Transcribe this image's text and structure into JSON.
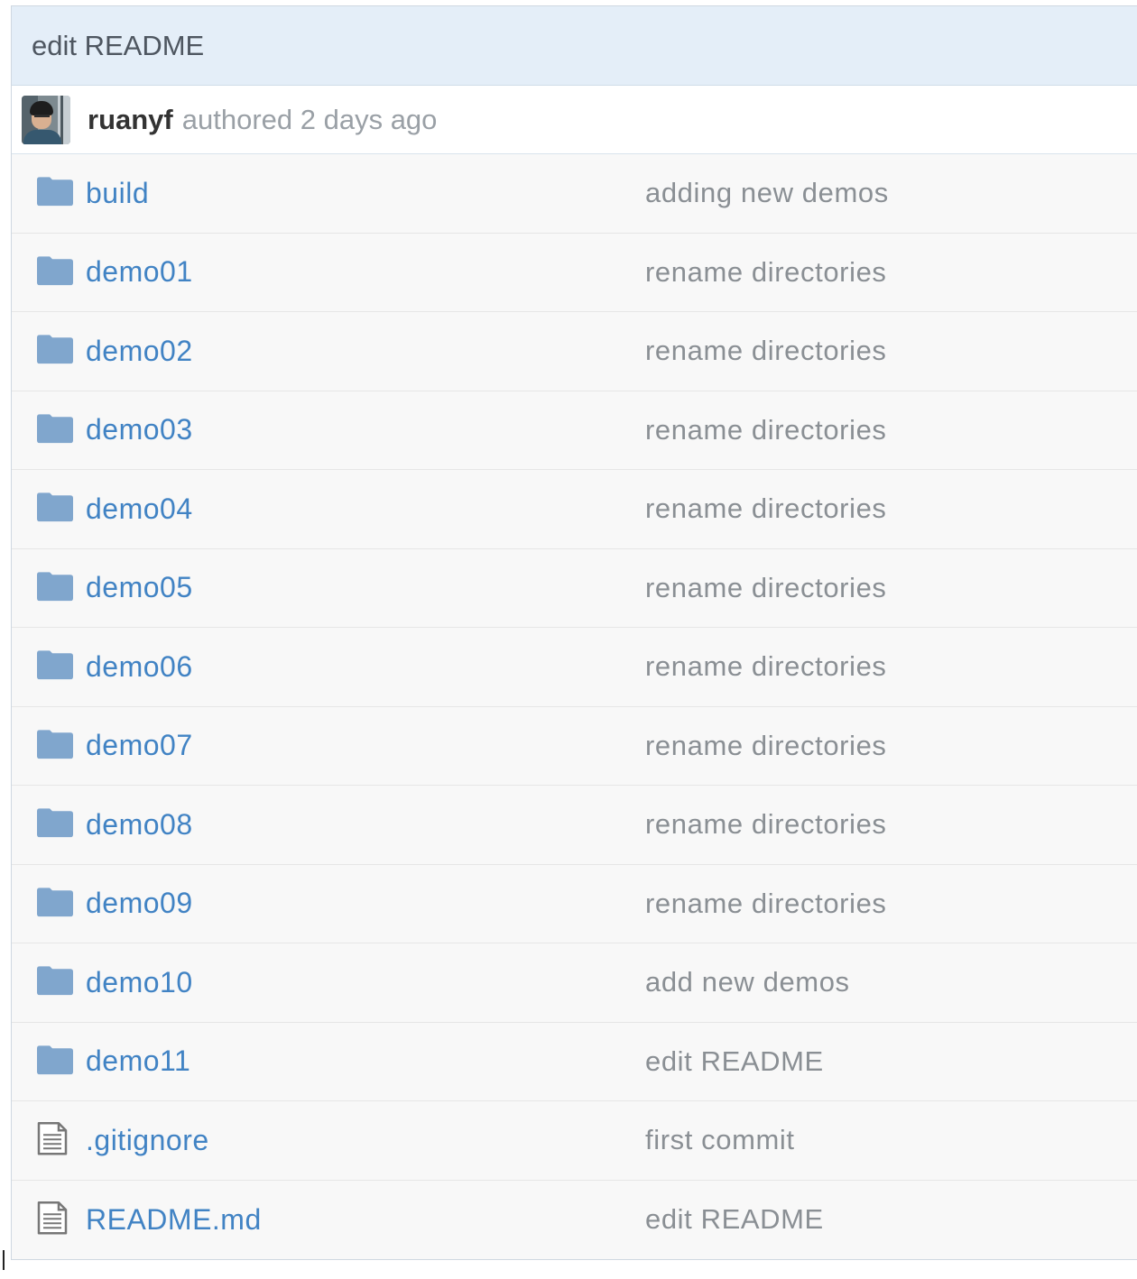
{
  "commit": {
    "title": "edit README",
    "author": "ruanyf",
    "authored_text": "authored 2 days ago"
  },
  "files": [
    {
      "name": "build",
      "type": "folder",
      "icon": "folder-icon",
      "message": "adding new demos"
    },
    {
      "name": "demo01",
      "type": "folder",
      "icon": "folder-icon",
      "message": "rename directories"
    },
    {
      "name": "demo02",
      "type": "folder",
      "icon": "folder-icon",
      "message": "rename directories"
    },
    {
      "name": "demo03",
      "type": "folder",
      "icon": "folder-icon",
      "message": "rename directories"
    },
    {
      "name": "demo04",
      "type": "folder",
      "icon": "folder-icon",
      "message": "rename directories"
    },
    {
      "name": "demo05",
      "type": "folder",
      "icon": "folder-icon",
      "message": "rename directories"
    },
    {
      "name": "demo06",
      "type": "folder",
      "icon": "folder-icon",
      "message": "rename directories"
    },
    {
      "name": "demo07",
      "type": "folder",
      "icon": "folder-icon",
      "message": "rename directories"
    },
    {
      "name": "demo08",
      "type": "folder",
      "icon": "folder-icon",
      "message": "rename directories"
    },
    {
      "name": "demo09",
      "type": "folder",
      "icon": "folder-icon",
      "message": "rename directories"
    },
    {
      "name": "demo10",
      "type": "folder",
      "icon": "folder-icon",
      "message": "add new demos"
    },
    {
      "name": "demo11",
      "type": "folder",
      "icon": "folder-icon",
      "message": "edit README"
    },
    {
      "name": ".gitignore",
      "type": "file",
      "icon": "file-text-icon",
      "message": "first commit"
    },
    {
      "name": "README.md",
      "type": "file",
      "icon": "file-text-icon",
      "message": "edit README"
    }
  ],
  "colors": {
    "link": "#4183c4",
    "folder_icon": "#80a6cd",
    "file_icon": "#777777",
    "header_bg": "#e4eef8",
    "row_bg": "#f8f8f8"
  }
}
